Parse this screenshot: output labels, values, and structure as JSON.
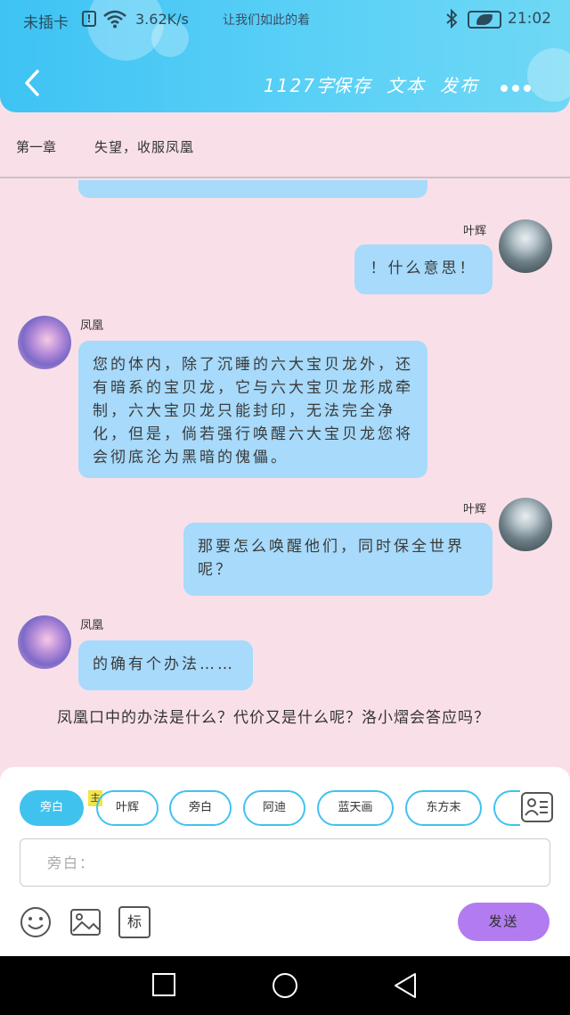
{
  "status": {
    "carrier": "未插卡",
    "speed": "3.62K/s",
    "note": "让我们如此的着",
    "time": "21:02"
  },
  "toolbar": {
    "word_count": "1127字",
    "save": "保存",
    "text": "文本",
    "publish": "发布"
  },
  "chapter": {
    "number": "第一章",
    "title": "失望，收服凤凰"
  },
  "messages": [
    {
      "speaker": "叶辉",
      "text": "！什么意思！"
    },
    {
      "speaker": "凤凰",
      "text": "您的体内，除了沉睡的六大宝贝龙外，还有暗系的宝贝龙，它与六大宝贝龙形成牵制，六大宝贝龙只能封印，无法完全净化，但是，倘若强行唤醒六大宝贝龙您将会彻底沦为黑暗的傀儡。"
    },
    {
      "speaker": "叶辉",
      "text": "那要怎么唤醒他们，同时保全世界呢？"
    },
    {
      "speaker": "凤凰",
      "text": "的确有个办法……"
    }
  ],
  "narration": "凤凰口中的办法是什么？代价又是什么呢？洛小熠会答应吗？",
  "roles": {
    "main_badge": "主",
    "chips": [
      "旁白",
      "叶辉",
      "旁白",
      "阿迪",
      "蓝天画",
      "东方末"
    ]
  },
  "input": {
    "placeholder": "旁白："
  },
  "tools": {
    "mark_label": "标",
    "send": "发送"
  },
  "colors": {
    "header": "#3ec3f4",
    "background": "#f9e0e8",
    "bubble": "#a7dafb",
    "send": "#b27cf0"
  }
}
